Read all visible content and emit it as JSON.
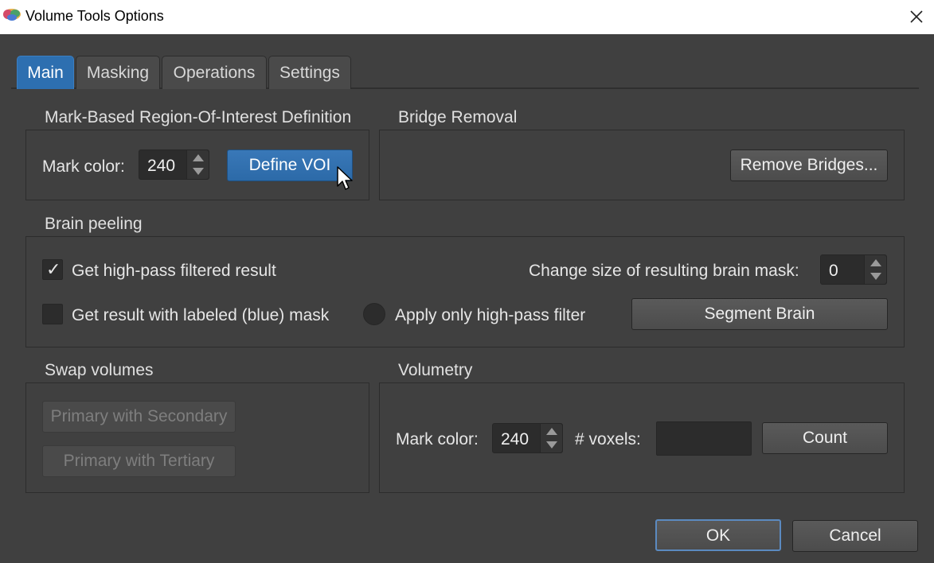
{
  "window": {
    "title": "Volume Tools Options"
  },
  "tabs": [
    {
      "label": "Main",
      "active": true
    },
    {
      "label": "Masking",
      "active": false
    },
    {
      "label": "Operations",
      "active": false
    },
    {
      "label": "Settings",
      "active": false
    }
  ],
  "roi": {
    "title": "Mark-Based Region-Of-Interest Definition",
    "mark_label": "Mark color:",
    "mark_value": "240",
    "define_button": "Define VOI"
  },
  "bridge": {
    "title": "Bridge Removal",
    "remove_button": "Remove Bridges..."
  },
  "peeling": {
    "title": "Brain peeling",
    "highpass_label": "Get high-pass filtered result",
    "highpass_checked": true,
    "labeled_label": "Get result with labeled (blue) mask",
    "labeled_checked": false,
    "apply_label": "Apply only high-pass filter",
    "size_label": "Change size of resulting brain mask:",
    "size_value": "0",
    "segment_button": "Segment Brain"
  },
  "swap": {
    "title": "Swap volumes",
    "secondary_button": "Primary with Secondary",
    "tertiary_button": "Primary with Tertiary"
  },
  "volumetry": {
    "title": "Volumetry",
    "mark_label": "Mark color:",
    "mark_value": "240",
    "voxels_label": "# voxels:",
    "voxels_value": "",
    "count_button": "Count"
  },
  "footer": {
    "ok": "OK",
    "cancel": "Cancel"
  },
  "colors": {
    "background": "#404040",
    "accent": "#2d6fb0",
    "field": "#2c2c2c"
  }
}
